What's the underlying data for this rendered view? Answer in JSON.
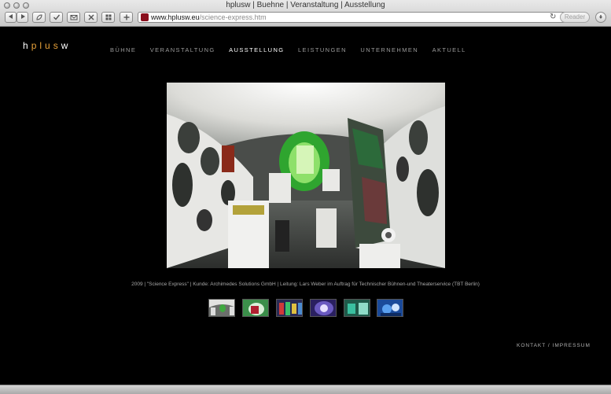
{
  "window": {
    "title": "hplusw | Buehne | Veranstaltung | Ausstellung"
  },
  "toolbar": {
    "back_icon": "back-arrow-icon",
    "forward_icon": "forward-arrow-icon",
    "address_domain": "www.hplusw.eu",
    "address_path": "/science-express.htm",
    "reload_glyph": "↻",
    "reader_label": "Reader"
  },
  "site": {
    "logo": [
      "h",
      "p",
      "l",
      "u",
      "s",
      "w"
    ],
    "nav": [
      {
        "label": "BÜHNE"
      },
      {
        "label": "VERANSTALTUNG"
      },
      {
        "label": "AUSSTELLUNG",
        "active": true
      },
      {
        "label": "LEISTUNGEN"
      },
      {
        "label": "UNTERNEHMEN"
      },
      {
        "label": "AKTUELL"
      }
    ],
    "caption": "2009 | \"Science Express\" | Kunde: Archimedes Solutions GmbH | Leitung: Lars Weber im Auftrag für Technischer Bühnen-und Theaterservice (TBT Berlin)",
    "thumbnail_count": 6,
    "footer": {
      "contact": "KONTAKT",
      "separator": " / ",
      "imprint": "IMPRESSUM"
    }
  },
  "colors": {
    "background": "#000000",
    "logo_accent": "#e8a23a",
    "nav_text": "#9a9a9a",
    "nav_active": "#ffffff"
  }
}
